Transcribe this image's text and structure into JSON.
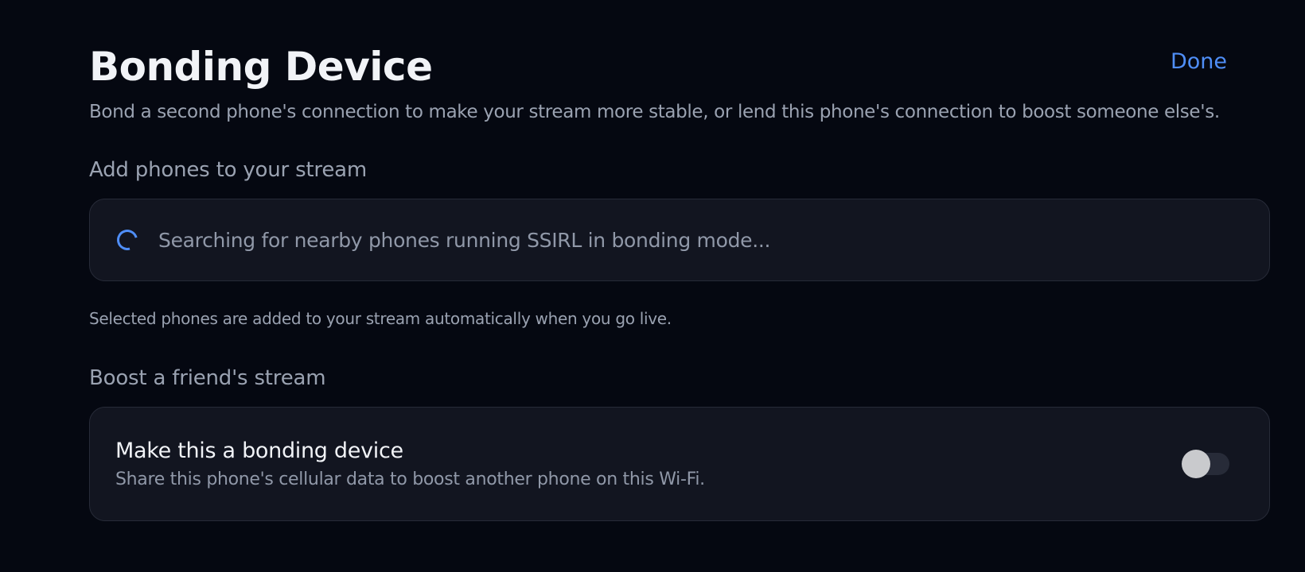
{
  "header": {
    "title": "Bonding Device",
    "done_label": "Done"
  },
  "subtitle": "Bond a second phone's connection to make your stream more stable, or lend this phone's connection to boost someone else's.",
  "add_section": {
    "label": "Add phones to your stream",
    "search_status": "Searching for nearby phones running SSIRL in bonding mode...",
    "helper": "Selected phones are added to your stream automatically when you go live."
  },
  "boost_section": {
    "label": "Boost a friend's stream",
    "toggle_title": "Make this a bonding device",
    "toggle_description": "Share this phone's cellular data to boost another phone on this Wi-Fi.",
    "toggle_state": "off"
  },
  "colors": {
    "accent": "#4f8ef7",
    "background": "#050811",
    "card": "#121520"
  },
  "icons": {
    "search_status": "spinner-icon"
  }
}
